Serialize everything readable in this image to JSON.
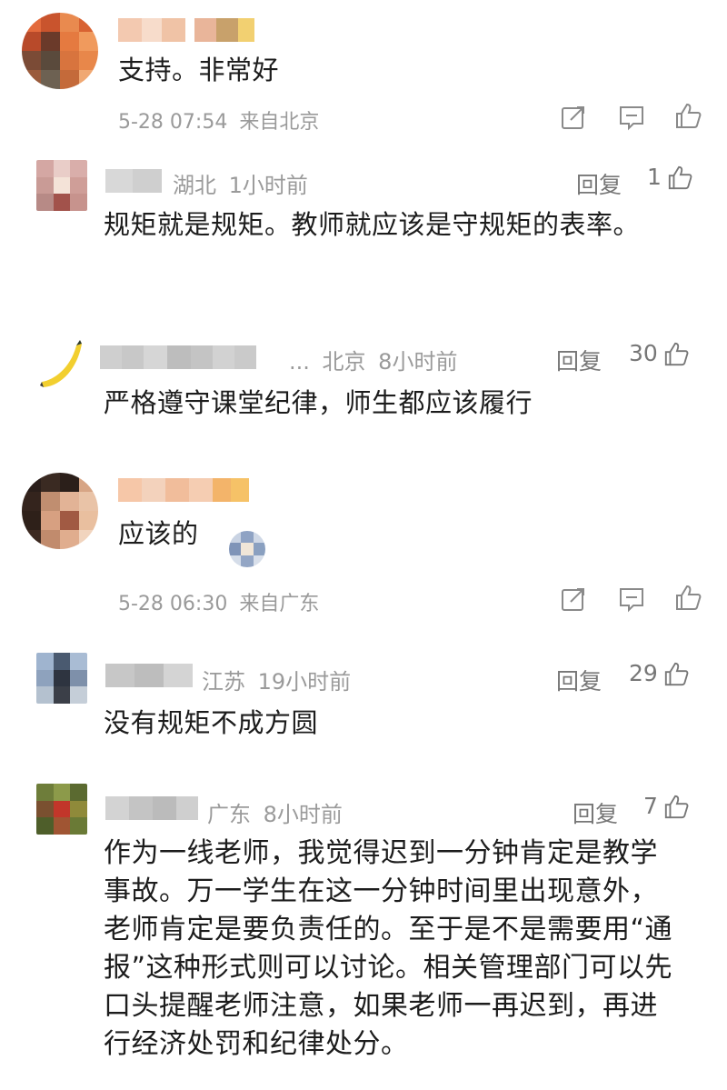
{
  "posts": [
    {
      "content": "支持。非常好",
      "time": "5-28 07:54",
      "location": "来自北京"
    },
    {
      "content": "应该的",
      "time": "5-28 06:30",
      "location": "来自广东"
    }
  ],
  "replies": [
    {
      "location": "湖北",
      "time": "1小时前",
      "reply_label": "回复",
      "likes": "1",
      "content": "规矩就是规矩。教师就应该是守规矩的表率。"
    },
    {
      "ellipsis": "...",
      "location": "北京",
      "time": "8小时前",
      "reply_label": "回复",
      "likes": "30",
      "content": "严格遵守课堂纪律，师生都应该履行"
    },
    {
      "location": "江苏",
      "time": "19小时前",
      "reply_label": "回复",
      "likes": "29",
      "content": "没有规矩不成方圆"
    },
    {
      "location": "广东",
      "time": "8小时前",
      "reply_label": "回复",
      "likes": "7",
      "content": "作为一线老师，我觉得迟到一分钟肯定是教学事故。万一学生在这一分钟时间里出现意外，老师肯定是要负责任的。至于是不是需要用“通报”这种形式则可以讨论。相关管理部门可以先口头提醒老师注意，如果老师一再迟到，再进行经济处罚和纪律处分。"
    }
  ],
  "icons": {
    "share": "share-icon",
    "comment": "comment-icon",
    "like": "thumbs-up-icon"
  },
  "colors": {
    "meta": "#9a9a9a",
    "text": "#1c1c1c",
    "vip_badge": "#f2a33a"
  }
}
